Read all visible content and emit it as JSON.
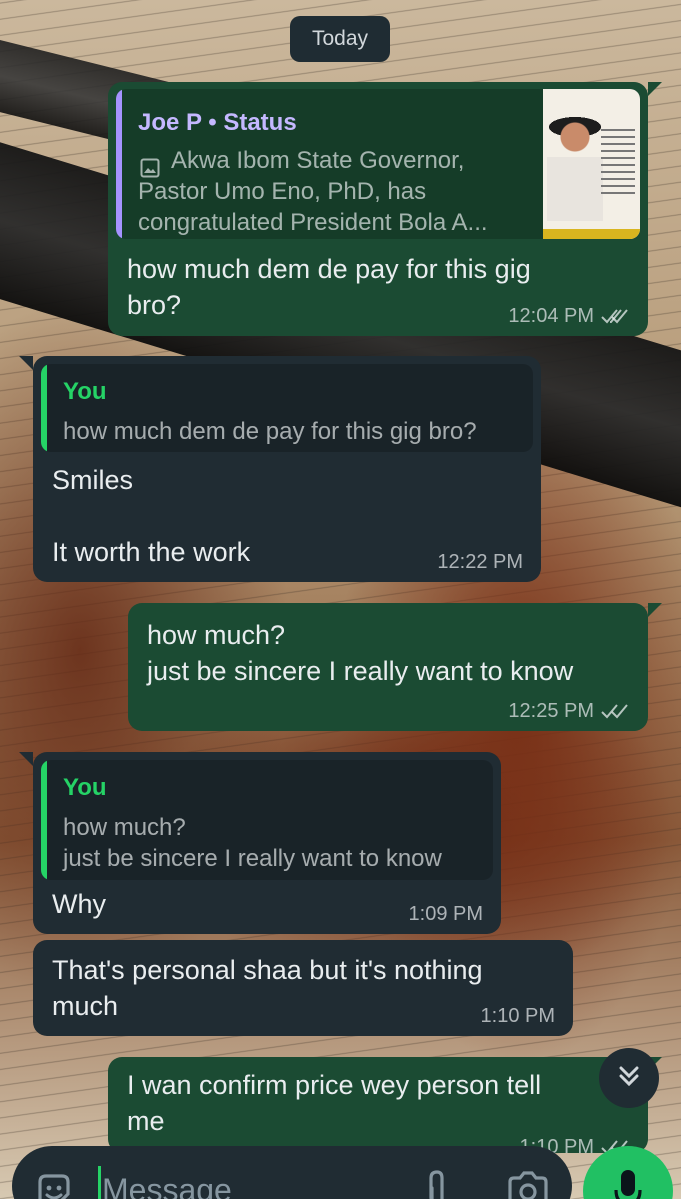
{
  "date_chip": "Today",
  "messages": [
    {
      "direction": "outgoing",
      "quote": {
        "title": "Joe P • Status",
        "image_icon": "image-icon",
        "body": "Akwa Ibom State Governor,\nPastor Umo Eno, PhD, has\ncongratulated President Bola A..."
      },
      "text": "how much dem de pay for this gig\nbro?",
      "time": "12:04 PM",
      "status": "read-double-check"
    },
    {
      "direction": "incoming",
      "quote": {
        "title": "You",
        "body": "how much dem de pay for this gig bro?"
      },
      "text": "Smiles\n\nIt worth the work",
      "time": "12:22 PM"
    },
    {
      "direction": "outgoing",
      "text": "how much?\njust be sincere I really want to know",
      "time": "12:25 PM",
      "status": "read-double-check"
    },
    {
      "direction": "incoming",
      "quote": {
        "title": "You",
        "body": "how much?\njust be sincere I really want to know"
      },
      "text": "Why",
      "time": "1:09 PM"
    },
    {
      "direction": "incoming",
      "text": "That's personal shaa but it's nothing\nmuch",
      "time": "1:10 PM"
    },
    {
      "direction": "outgoing",
      "text": "I wan confirm price wey person tell\nme",
      "time": "1:10 PM",
      "status": "read-double-check"
    }
  ],
  "composer": {
    "placeholder": "Message",
    "icons": [
      "sticker-icon",
      "attach-icon",
      "camera-icon",
      "mic-icon"
    ]
  },
  "colors": {
    "outgoing_bubble": "#1b4b33",
    "incoming_bubble": "#202c33",
    "status_quote_bar": "#a593ff",
    "status_quote_title": "#c4b8ff",
    "you_quote": "#25d366",
    "mic_button": "#21c063"
  }
}
